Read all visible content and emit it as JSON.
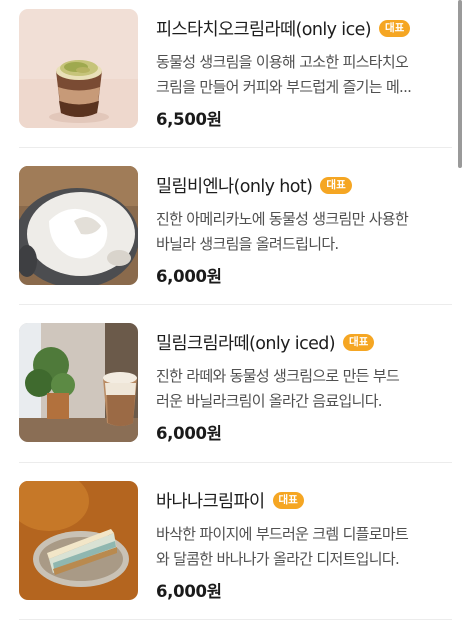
{
  "menu": {
    "items": [
      {
        "name": "피스타치오크림라떼(only ice)",
        "badge": "대표",
        "description": "동물성 생크림을 이용해 고소한 피스타치오\n크림을 만들어 커피와 부드럽게 즐기는 메...",
        "price": "6,500원"
      },
      {
        "name": "밀림비엔나(only hot)",
        "badge": "대표",
        "description": "진한 아메리카노에 동물성 생크림만 사용한\n바닐라 생크림을 올려드립니다.",
        "price": "6,000원"
      },
      {
        "name": "밀림크림라떼(only iced)",
        "badge": "대표",
        "description": "진한 라떼와 동물성 생크림으로 만든 부드\n러운 바닐라크림이 올라간 음료입니다.",
        "price": "6,000원"
      },
      {
        "name": "바나나크림파이",
        "badge": "대표",
        "description": "바삭한 파이지에 부드러운 크렘 디플로마트\n와 달콤한 바나나가 올라간 디저트입니다.",
        "price": "6,000원"
      }
    ]
  },
  "colors": {
    "badge": "#f5a623",
    "price": "#1a1a1a",
    "description": "#505050"
  }
}
